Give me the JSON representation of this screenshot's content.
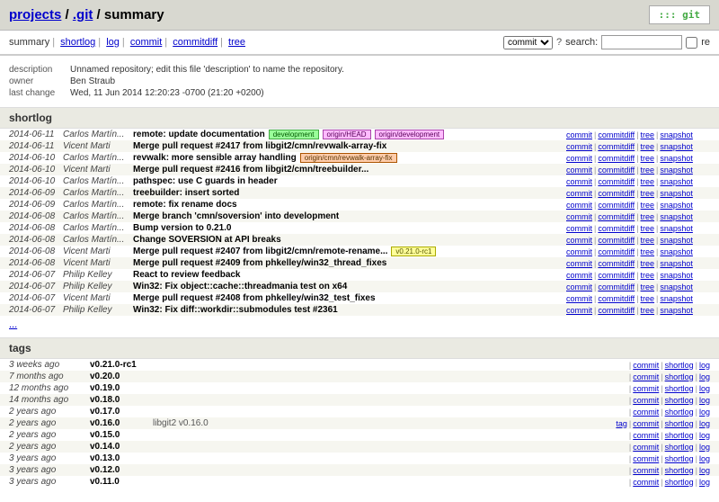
{
  "breadcrumb": {
    "projects": "projects",
    "repo": ".git",
    "page": "summary"
  },
  "gitlogo_text": "::: git",
  "nav": {
    "summary": "summary",
    "shortlog": "shortlog",
    "log": "log",
    "commit": "commit",
    "commitdiff": "commitdiff",
    "tree": "tree"
  },
  "search": {
    "type_selected": "commit",
    "label": "search:",
    "re_label": "re"
  },
  "meta": {
    "description_label": "description",
    "description_value": "Unnamed repository; edit this file 'description' to name the repository.",
    "owner_label": "owner",
    "owner_value": "Ben Straub",
    "lastchange_label": "last change",
    "lastchange_value": "Wed, 11 Jun 2014 12:20:23 -0700 (21:20 +0200)"
  },
  "section_shortlog": "shortlog",
  "shortlog_actions": {
    "commit": "commit",
    "commitdiff": "commitdiff",
    "tree": "tree",
    "snapshot": "snapshot"
  },
  "shortlog": [
    {
      "date": "2014-06-11",
      "author": "Carlos Martín...",
      "subject": "remote: update documentation",
      "badges": [
        {
          "text": "development",
          "cls": "green"
        },
        {
          "text": "origin/HEAD",
          "cls": "pink"
        },
        {
          "text": "origin/development",
          "cls": "pink"
        }
      ]
    },
    {
      "date": "2014-06-11",
      "author": "Vicent Marti",
      "subject": "Merge pull request #2417 from libgit2/cmn/revwalk-array-fix",
      "badges": []
    },
    {
      "date": "2014-06-10",
      "author": "Carlos Martín...",
      "subject": "revwalk: more sensible array handling",
      "badges": [
        {
          "text": "origin/cmn/revwalk-array-fix",
          "cls": "orange"
        }
      ]
    },
    {
      "date": "2014-06-10",
      "author": "Vicent Marti",
      "subject": "Merge pull request #2416 from libgit2/cmn/treebuilder...",
      "badges": []
    },
    {
      "date": "2014-06-10",
      "author": "Carlos Martín...",
      "subject": "pathspec: use C guards in header",
      "badges": []
    },
    {
      "date": "2014-06-09",
      "author": "Carlos Martín...",
      "subject": "treebuilder: insert sorted",
      "badges": []
    },
    {
      "date": "2014-06-09",
      "author": "Carlos Martín...",
      "subject": "remote: fix rename docs",
      "badges": []
    },
    {
      "date": "2014-06-08",
      "author": "Carlos Martín...",
      "subject": "Merge branch 'cmn/soversion' into development",
      "badges": []
    },
    {
      "date": "2014-06-08",
      "author": "Carlos Martín...",
      "subject": "Bump version to 0.21.0",
      "badges": []
    },
    {
      "date": "2014-06-08",
      "author": "Carlos Martín...",
      "subject": "Change SOVERSION at API breaks",
      "badges": []
    },
    {
      "date": "2014-06-08",
      "author": "Vicent Marti",
      "subject": "Merge pull request #2407 from libgit2/cmn/remote-rename...",
      "badges": [
        {
          "text": "v0.21.0-rc1",
          "cls": "yellow"
        }
      ]
    },
    {
      "date": "2014-06-08",
      "author": "Vicent Marti",
      "subject": "Merge pull request #2409 from phkelley/win32_thread_fixes",
      "badges": []
    },
    {
      "date": "2014-06-07",
      "author": "Philip Kelley",
      "subject": "React to review feedback",
      "badges": []
    },
    {
      "date": "2014-06-07",
      "author": "Philip Kelley",
      "subject": "Win32: Fix object::cache::threadmania test on x64",
      "badges": []
    },
    {
      "date": "2014-06-07",
      "author": "Vicent Marti",
      "subject": "Merge pull request #2408 from phkelley/win32_test_fixes",
      "badges": []
    },
    {
      "date": "2014-06-07",
      "author": "Philip Kelley",
      "subject": "Win32: Fix diff::workdir::submodules test #2361",
      "badges": []
    }
  ],
  "more": "...",
  "section_tags": "tags",
  "tag_actions": {
    "tag": "tag",
    "commit": "commit",
    "shortlog": "shortlog",
    "log": "log"
  },
  "tags": [
    {
      "age": "3 weeks ago",
      "name": "v0.21.0-rc1",
      "msg": "",
      "has_tag": false
    },
    {
      "age": "7 months ago",
      "name": "v0.20.0",
      "msg": "",
      "has_tag": false
    },
    {
      "age": "12 months ago",
      "name": "v0.19.0",
      "msg": "",
      "has_tag": false
    },
    {
      "age": "14 months ago",
      "name": "v0.18.0",
      "msg": "",
      "has_tag": false
    },
    {
      "age": "2 years ago",
      "name": "v0.17.0",
      "msg": "",
      "has_tag": false
    },
    {
      "age": "2 years ago",
      "name": "v0.16.0",
      "msg": "libgit2 v0.16.0",
      "has_tag": true
    },
    {
      "age": "2 years ago",
      "name": "v0.15.0",
      "msg": "",
      "has_tag": false
    },
    {
      "age": "2 years ago",
      "name": "v0.14.0",
      "msg": "",
      "has_tag": false
    },
    {
      "age": "3 years ago",
      "name": "v0.13.0",
      "msg": "",
      "has_tag": false
    },
    {
      "age": "3 years ago",
      "name": "v0.12.0",
      "msg": "",
      "has_tag": false
    },
    {
      "age": "3 years ago",
      "name": "v0.11.0",
      "msg": "",
      "has_tag": false
    }
  ]
}
